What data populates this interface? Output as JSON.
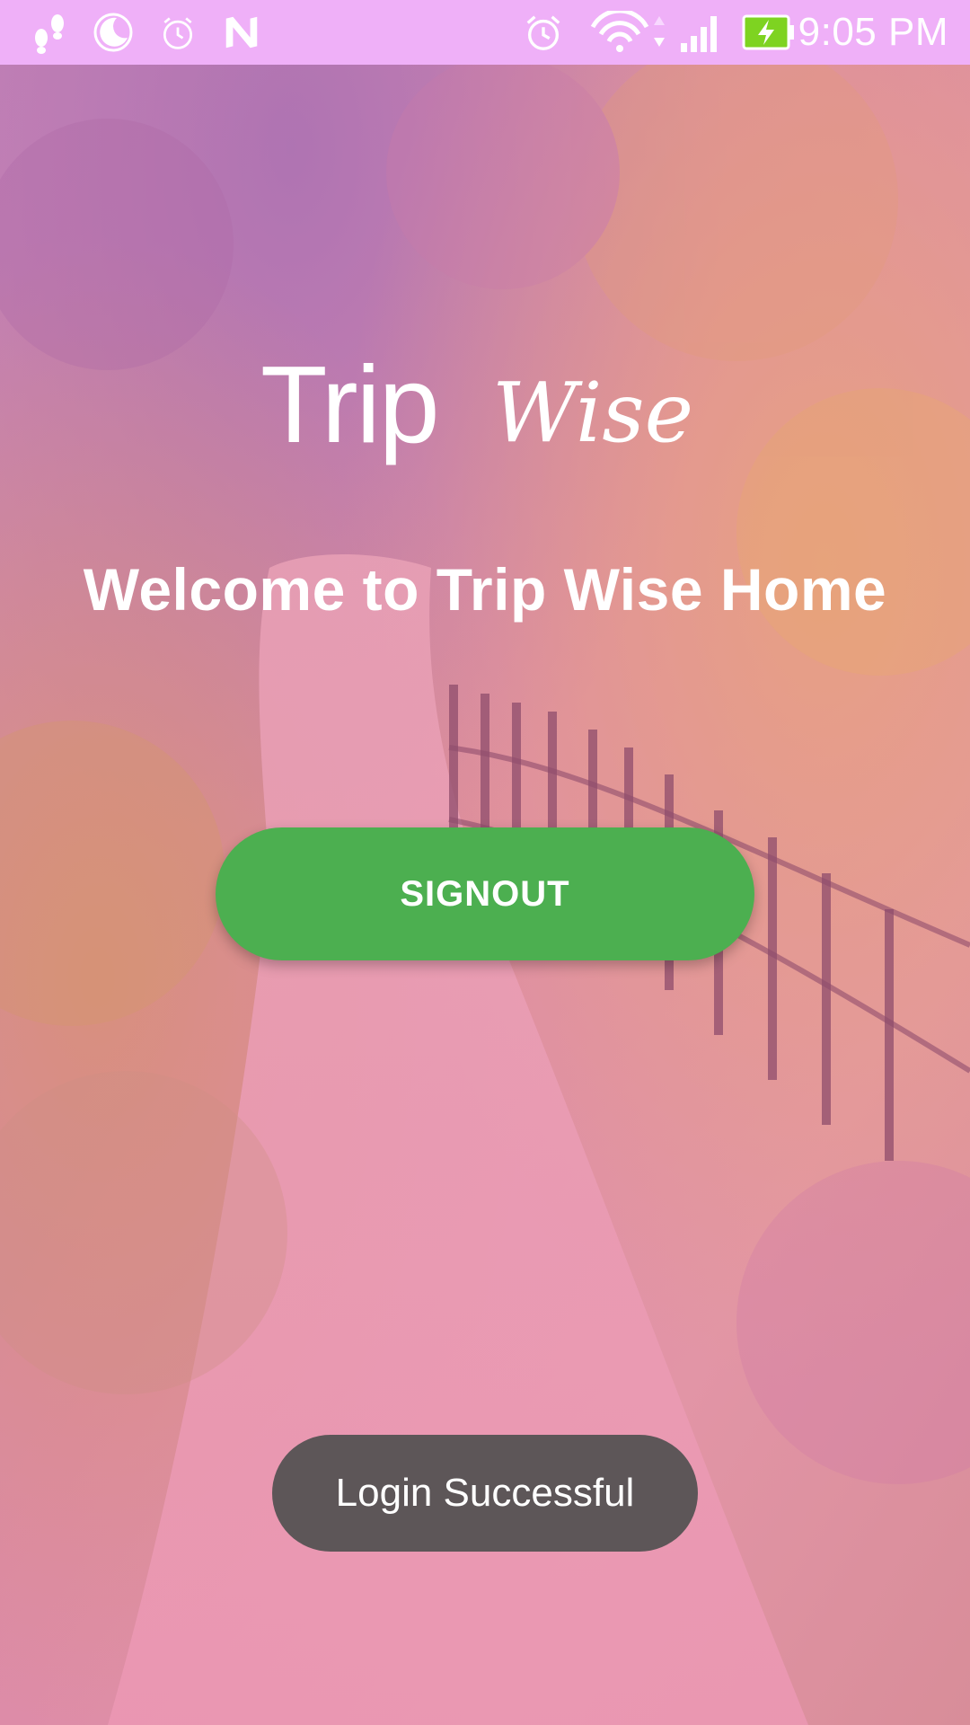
{
  "status_bar": {
    "time": "9:05 PM",
    "background": "#efb0f8",
    "icons": [
      "footsteps-icon",
      "moon-icon",
      "alarm-icon",
      "n-notification-icon",
      "alarm-clock-icon",
      "wifi-icon",
      "signal-icon",
      "battery-charging-icon"
    ]
  },
  "logo": {
    "word1": "Trip",
    "word2": "Wise"
  },
  "welcome_text": "Welcome to Trip Wise Home",
  "signout_label": "SIGNOUT",
  "toast_text": "Login Successful",
  "colors": {
    "button": "#4caf50",
    "overlay_tint": "#e07aae",
    "battery": "#7ed321"
  }
}
